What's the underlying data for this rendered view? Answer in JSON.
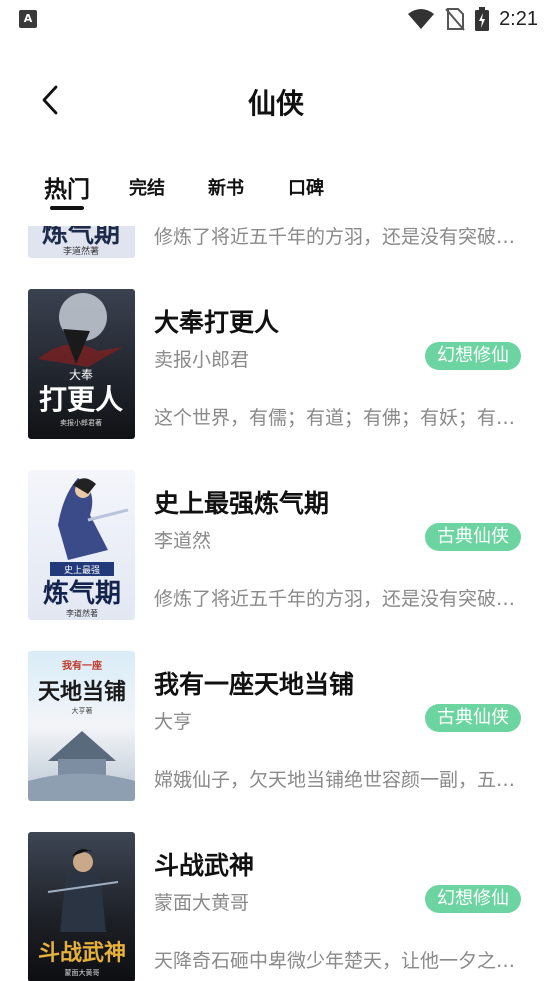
{
  "status_bar": {
    "time": "2:21",
    "left_icon_label": "A"
  },
  "header": {
    "title": "仙侠"
  },
  "tabs": [
    {
      "label": "热门"
    },
    {
      "label": "完结"
    },
    {
      "label": "新书"
    },
    {
      "label": "口碑"
    }
  ],
  "active_tab": "热门",
  "partial_book": {
    "desc": "修炼了将近五千年的方羽，还是没有突破…",
    "cover_text_bottom": "李道然著"
  },
  "books": [
    {
      "title": "大奉打更人",
      "author": "卖报小郎君",
      "tag": "幻想修仙",
      "desc": "这个世界，有儒；有道；有佛；有妖；有…",
      "cover_text": "打更人",
      "cover_small": "大奉",
      "cover_author": "卖报小郎君著"
    },
    {
      "title": "史上最强炼气期",
      "author": "李道然",
      "tag": "古典仙侠",
      "desc": "修炼了将近五千年的方羽，还是没有突破…",
      "cover_text": "炼气期",
      "cover_small": "史上最强",
      "cover_author": "李道然著"
    },
    {
      "title": "我有一座天地当铺",
      "author": "大亨",
      "tag": "古典仙侠",
      "desc": "嫦娥仙子，欠天地当铺绝世容颜一副，五…",
      "cover_text": "天地当铺",
      "cover_small": "我有一座",
      "cover_author": "大亨著"
    },
    {
      "title": "斗战武神",
      "author": "蒙面大黄哥",
      "tag": "幻想修仙",
      "desc": "天降奇石砸中卑微少年楚天，让他一夕之…",
      "cover_text": "斗战武神",
      "cover_small": "",
      "cover_author": "蒙面大黄哥"
    }
  ],
  "colors": {
    "tag_bg": "#6cd4a0",
    "secondary_text": "#8a8a8a",
    "primary_text": "#111111"
  }
}
